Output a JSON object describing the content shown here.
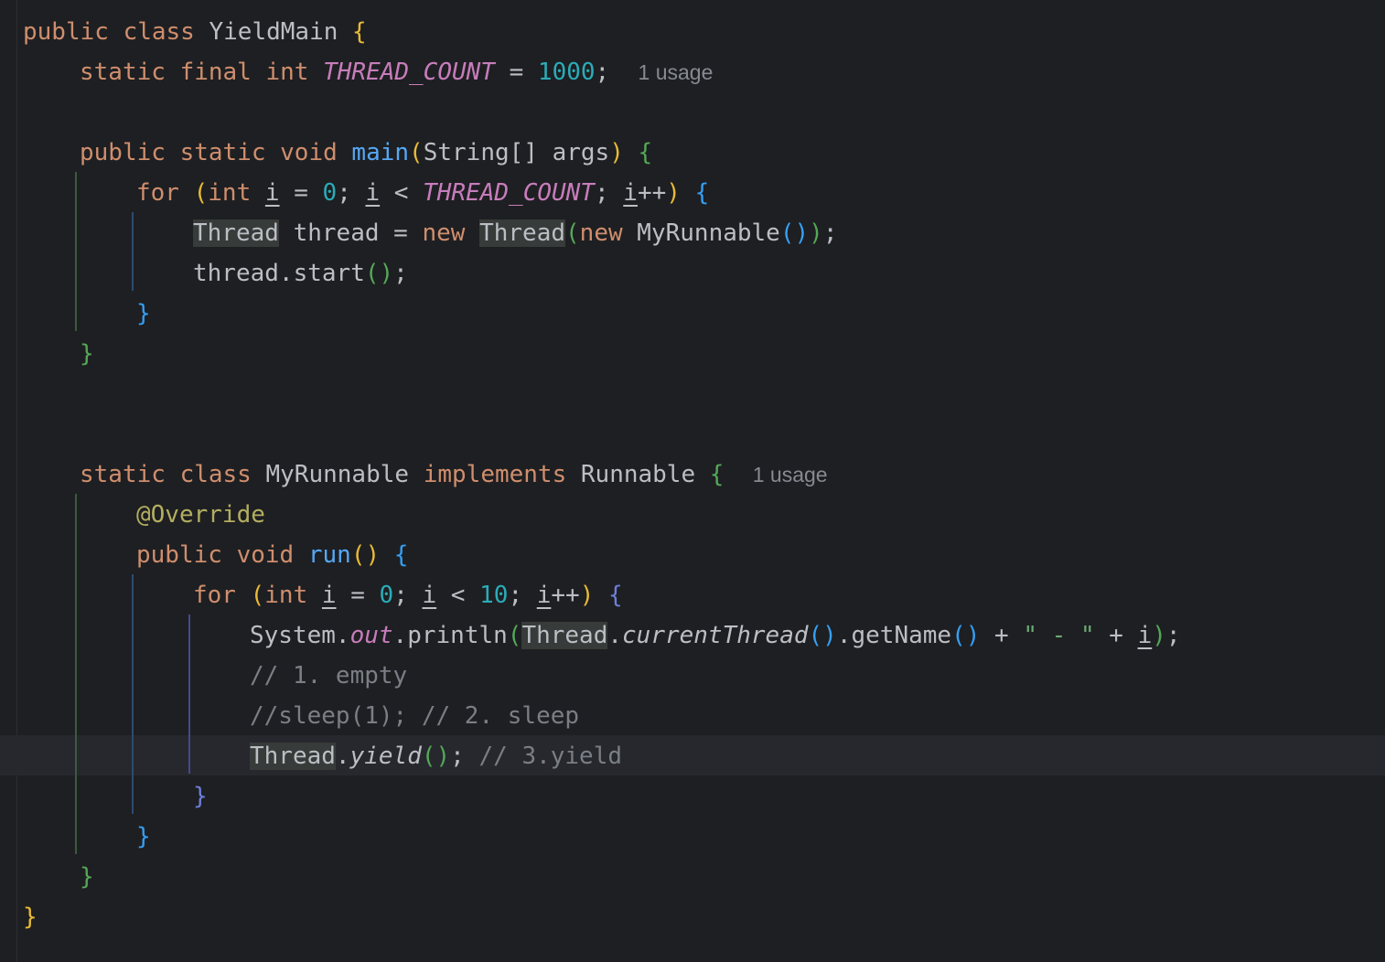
{
  "editor": {
    "class_name": "YieldMain",
    "const_name": "THREAD_COUNT",
    "const_value": "1000",
    "usage_hint_1": "1 usage",
    "main_method": "main",
    "main_params_type": "String[]",
    "main_params_name": "args",
    "loop_var": "i",
    "loop_start": "0",
    "thread_type": "Thread",
    "thread_var": "thread",
    "runnable_class": "MyRunnable",
    "start_call": "start",
    "inner_class_name": "MyRunnable",
    "interface_name": "Runnable",
    "usage_hint_2": "1 usage",
    "annotation": "@Override",
    "run_method": "run",
    "inner_loop_limit": "10",
    "sysout_obj": "System",
    "sysout_field": "out",
    "println": "println",
    "current_thread": "currentThread",
    "get_name": "getName",
    "string_literal": "\" - \"",
    "comment_1": "// 1. empty",
    "comment_2": "//sleep(1); // 2. sleep",
    "yield_call": "yield",
    "comment_3": "// 3.yield"
  },
  "colors": {
    "background": "#1e1f22",
    "keyword": "#cf8e6d",
    "function": "#56a8f5",
    "number": "#2aacb8",
    "constant": "#c77dbb",
    "annotation": "#b3ae60",
    "string": "#6aab73",
    "comment": "#7a7e85"
  }
}
